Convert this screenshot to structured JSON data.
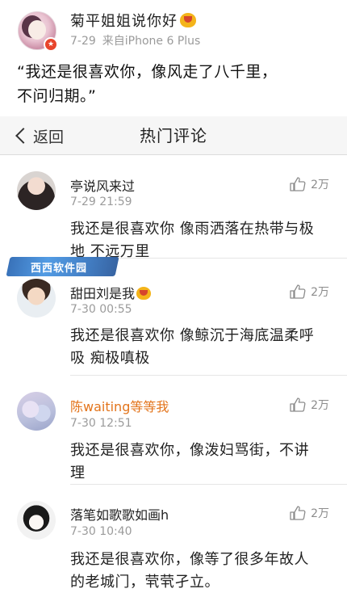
{
  "post": {
    "author": "菊平姐姐说你好",
    "date": "7-29",
    "source": "来自iPhone 6 Plus",
    "text_line1": "“我还是很喜欢你，像风走了八千里，",
    "text_line2": "不问归期。”"
  },
  "nav": {
    "back_label": "返回",
    "title": "热门评论"
  },
  "comments": [
    {
      "name": "亭说风来过",
      "time": "7-29 21:59",
      "likes": "2万",
      "line1": "我还是很喜欢你 像雨洒落在热带与极",
      "line2": "地 不远万里"
    },
    {
      "name": "甜田刘是我",
      "time": "7-30 00:55",
      "likes": "2万",
      "line1": "我还是很喜欢你 像鲸沉于海底温柔呼",
      "line2": "吸 痴极嗔极"
    },
    {
      "name": "陈waiting等等我",
      "time": "7-30 12:51",
      "likes": "2万",
      "line1": "我还是很喜欢你，像泼妇骂街，不讲",
      "line2": "理"
    },
    {
      "name": "落笔如歌歌如画h",
      "time": "7-30 10:40",
      "likes": "2万",
      "line1": "我还是很喜欢你，像等了很多年故人",
      "line2": "的老城门，茕茕孑立。"
    }
  ],
  "watermark": {
    "text": "西西软件园"
  },
  "icons": {
    "like": "thumbs-up-icon",
    "back": "chevron-left-icon",
    "vip": "vip-crown-icon",
    "verified": "verified-badge-icon"
  },
  "colors": {
    "accent_orange": "#e3741b",
    "meta_gray": "#9b9b9b",
    "nav_bg": "#f6f6f6"
  }
}
